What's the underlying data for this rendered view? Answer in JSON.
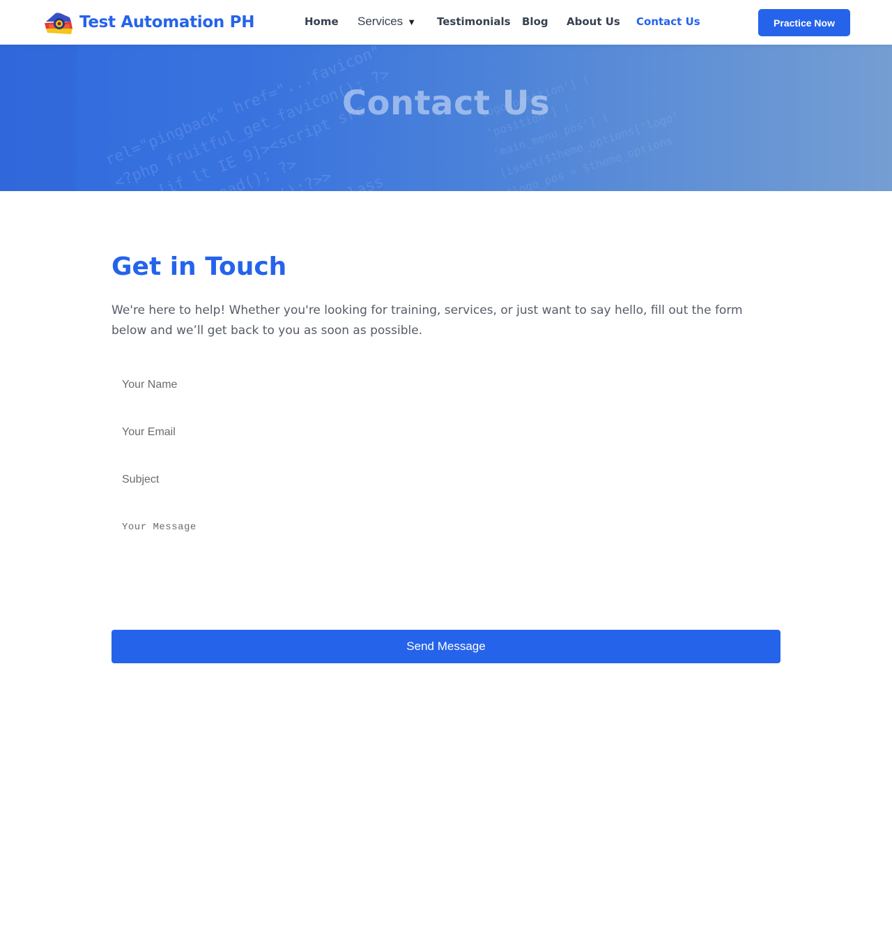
{
  "brand": {
    "name": "Test Automation PH",
    "logo_icon": "flag-house-logo-icon"
  },
  "nav": {
    "home": "Home",
    "services": "Services",
    "services_caret": "▼",
    "testimonials": "Testimonials",
    "blog": "Blog",
    "about": "About Us",
    "contact": "Contact Us",
    "active_item": "Contact Us"
  },
  "header": {
    "cta_label": "Practice Now"
  },
  "hero": {
    "title": "Contact Us"
  },
  "contact": {
    "heading": "Get in Touch",
    "intro": "We're here to help! Whether you're looking for training, services, or just want to say hello, fill out the form below and we’ll get back to you as soon as possible.",
    "form": {
      "name_placeholder": "Your Name",
      "email_placeholder": "Your Email",
      "subject_placeholder": "Subject",
      "message_placeholder": "Your Message",
      "submit_label": "Send Message"
    }
  },
  "colors": {
    "accent": "#2563eb",
    "nav_text": "#374151",
    "body_text": "#555b66"
  }
}
